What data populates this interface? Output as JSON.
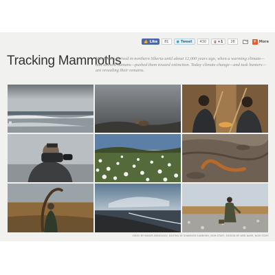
{
  "share": {
    "like_label": "Like",
    "like_count": "81",
    "tweet_label": "Tweet",
    "tweet_count": "430",
    "gplus_label": "+1",
    "gplus_count": "28",
    "more_label": "More"
  },
  "header": {
    "title": "Tracking Mammoths",
    "dek": "Mammoths thrived in northern Siberia until about 12,000 years ago, when a warming climate—and ancient humans—pushed them toward extinction. Today climate change—and tusk hunters—are revealing their remains."
  },
  "credits": "VIDEO BY MAXIM ARBUGAEV; EDITING BY SHANNON SANBORN, NGM STAFF; DESIGN BY WEB BARR, NGM STAFF",
  "icons": {
    "like": "facebook-like-icon",
    "tweet": "twitter-bird-icon",
    "gplus": "google-plus-icon",
    "mail": "email-icon",
    "more": "plus-icon"
  }
}
